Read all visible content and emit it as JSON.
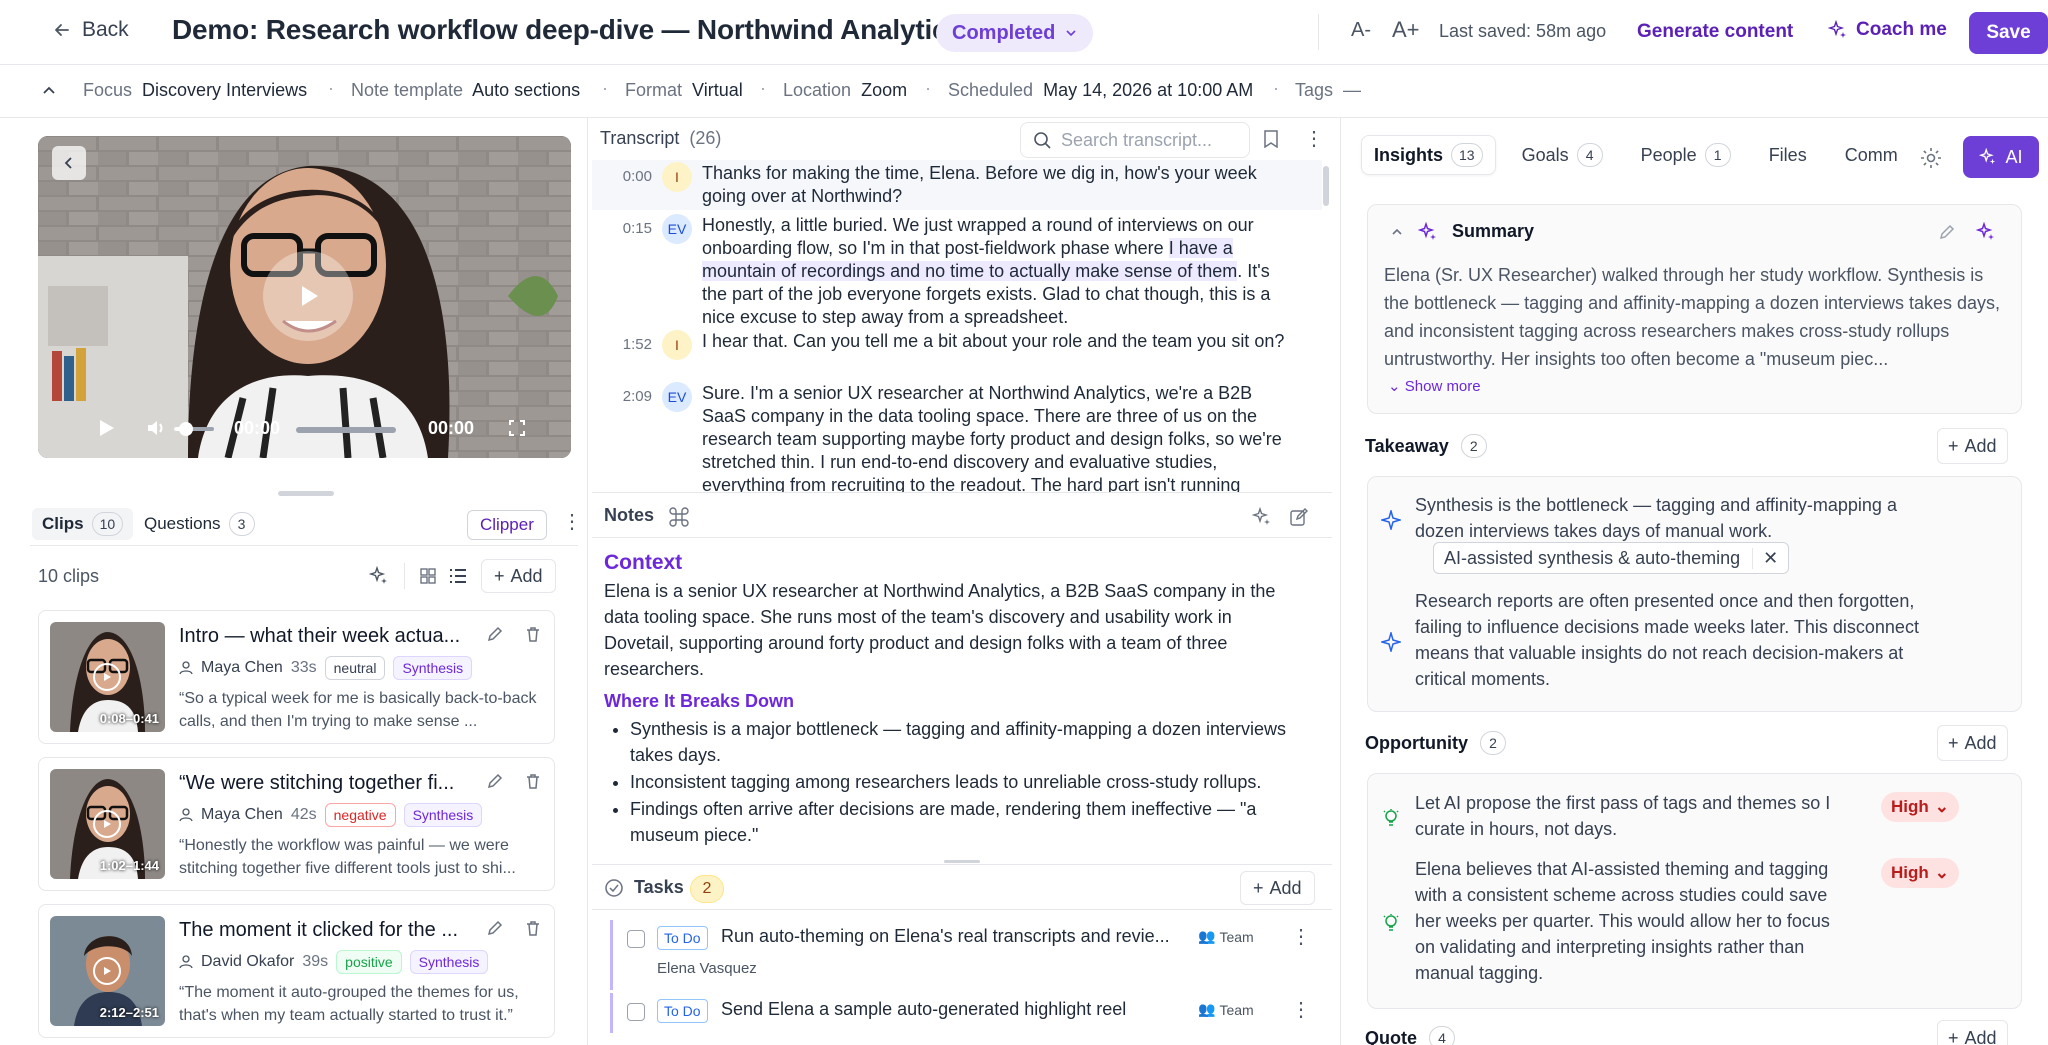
{
  "header": {
    "back_label": "Back",
    "title": "Demo: Research workflow deep-dive — Northwind Analytics",
    "status": "Completed",
    "font_smaller": "A-",
    "font_larger": "A+",
    "last_saved": "Last saved: 58m ago",
    "generate_label": "Generate content",
    "coach_label": "Coach me",
    "save_label": "Save"
  },
  "meta": {
    "focus_label": "Focus",
    "focus_value": "Discovery Interviews",
    "template_label": "Note template",
    "template_value": "Auto sections",
    "format_label": "Format",
    "format_value": "Virtual",
    "location_label": "Location",
    "location_value": "Zoom",
    "scheduled_label": "Scheduled",
    "scheduled_value": "May 14, 2026 at 10:00 AM",
    "tags_label": "Tags",
    "tags_value": "—"
  },
  "video": {
    "current_time": "00:00",
    "duration": "00:00",
    "volume_level": 0.3,
    "progress": 0
  },
  "clips_panel": {
    "tabs": [
      {
        "label": "Clips",
        "count": "10"
      },
      {
        "label": "Questions",
        "count": "3"
      }
    ],
    "clipper_label": "Clipper",
    "count_text": "10 clips",
    "add_label": "Add",
    "clips": [
      {
        "title": "Intro — what their week actua...",
        "person": "Maya Chen",
        "duration": "33s",
        "sentiment": "neutral",
        "theme": "Synthesis",
        "range": "0:08–0:41",
        "quote": "“So a typical week for me is basically back-to-back calls, and then I'm trying to make sense ..."
      },
      {
        "title": "“We were stitching together fi...",
        "person": "Maya Chen",
        "duration": "42s",
        "sentiment": "negative",
        "theme": "Synthesis",
        "range": "1:02–1:44",
        "quote": "“Honestly the workflow was painful — we were stitching together five different tools just to shi..."
      },
      {
        "title": "The moment it clicked for the ...",
        "person": "David Okafor",
        "duration": "39s",
        "sentiment": "positive",
        "theme": "Synthesis",
        "range": "2:12–2:51",
        "quote": "“The moment it auto-grouped the themes for us, that's when my team actually started to trust it.”"
      }
    ]
  },
  "transcript": {
    "title": "Transcript",
    "count": "(26)",
    "search_placeholder": "Search transcript...",
    "lines": [
      {
        "time": "0:00",
        "speaker": "I",
        "pre": "Thanks for making the time, Elena. Before we dig in, how's your week going over at Northwind?",
        "hl": "",
        "post": ""
      },
      {
        "time": "0:15",
        "speaker": "EV",
        "pre": "Honestly, a little buried. We just wrapped a round of interviews on our onboarding flow, so I'm in that post-fieldwork phase where ",
        "hl": "I have a mountain of recordings and no time to actually make sense of them",
        "post": ". It's the part of the job everyone forgets exists. Glad to chat though, this is a nice excuse to step away from a spreadsheet."
      },
      {
        "time": "1:52",
        "speaker": "I",
        "pre": "I hear that. Can you tell me a bit about your role and the team you sit on?",
        "hl": "",
        "post": ""
      },
      {
        "time": "2:09",
        "speaker": "EV",
        "pre": "Sure. I'm a senior UX researcher at Northwind Analytics, we're a B2B SaaS company in the data tooling space. There are three of us on the research team supporting maybe forty product and design folks, so we're stretched thin. I run end-to-end discovery and evaluative studies, everything from recruiting to the readout. The hard part isn't running",
        "hl": "",
        "post": ""
      }
    ]
  },
  "notes": {
    "title": "Notes",
    "context_heading": "Context",
    "context_text": "Elena is a senior UX researcher at Northwind Analytics, a B2B SaaS company in the data tooling space. She runs most of the team's discovery and usability work in Dovetail, supporting around forty product and design folks with a team of three researchers.",
    "breaks_heading": "Where It Breaks Down",
    "bullets": [
      "Synthesis is a major bottleneck — tagging and affinity-mapping a dozen interviews takes days.",
      "Inconsistent tagging among researchers leads to unreliable cross-study rollups.",
      "Findings often arrive after decisions are made, rendering them ineffective — \"a museum piece.\""
    ]
  },
  "tasks": {
    "title": "Tasks",
    "count": "2",
    "add_label": "Add",
    "items": [
      {
        "status": "To Do",
        "title": "Run auto-theming on Elena's real transcripts and revie...",
        "team": "Team",
        "assignee": "Elena Vasquez"
      },
      {
        "status": "To Do",
        "title": "Send Elena a sample auto-generated highlight reel",
        "team": "Team",
        "assignee": ""
      }
    ]
  },
  "right": {
    "tabs": [
      {
        "label": "Insights",
        "count": "13"
      },
      {
        "label": "Goals",
        "count": "4"
      },
      {
        "label": "People",
        "count": "1"
      },
      {
        "label": "Files",
        "count": ""
      },
      {
        "label": "Comm",
        "count": ""
      }
    ],
    "ai_label": "AI",
    "summary_title": "Summary",
    "summary_text": "Elena (Sr. UX Researcher) walked through her study workflow. Synthesis is the bottleneck — tagging and affinity-mapping a dozen interviews takes days, and inconsistent tagging across researchers makes cross-study rollups untrustworthy. Her insights too often become a \"museum piec...",
    "show_more": "Show more",
    "takeaway": {
      "title": "Takeaway",
      "count": "2",
      "add_label": "Add",
      "items": [
        "Synthesis is the bottleneck — tagging and affinity-mapping a dozen interviews takes days of manual work.",
        "Research reports are often presented once and then forgotten, failing to influence decisions made weeks later. This disconnect means that valuable insights do not reach decision-makers at critical moments."
      ],
      "linked_pill": "AI-assisted synthesis & auto-theming"
    },
    "opportunity": {
      "title": "Opportunity",
      "count": "2",
      "add_label": "Add",
      "items": [
        {
          "text": "Let AI propose the first pass of tags and themes so I curate in hours, not days.",
          "priority": "High"
        },
        {
          "text": "Elena believes that AI-assisted theming and tagging with a consistent scheme across studies could save her weeks per quarter. This would allow her to focus on validating and interpreting insights rather than manual tagging.",
          "priority": "High"
        }
      ]
    },
    "quote": {
      "title": "Quote",
      "count": "4",
      "add_label": "Add"
    }
  }
}
